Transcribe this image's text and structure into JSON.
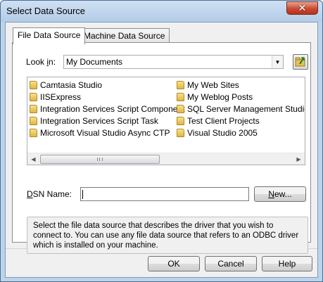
{
  "window": {
    "title": "Select Data Source",
    "close_label": "✕"
  },
  "tabs": [
    {
      "label": "File Data Source",
      "active": true
    },
    {
      "label": "Machine Data Source",
      "active": false
    }
  ],
  "look_in": {
    "label_prefix": "Look ",
    "label_underline": "i",
    "label_suffix": "n:",
    "value": "My Documents"
  },
  "files": [
    "Camtasia Studio",
    "IISExpress",
    "Integration Services Script Component",
    "Integration Services Script Task",
    "Microsoft Visual Studio Async CTP",
    "My Web Sites",
    "My Weblog Posts",
    "SQL Server Management Studio",
    "Test Client Projects",
    "Visual Studio 2005"
  ],
  "dsn": {
    "label_underline": "D",
    "label_rest": "SN Name:",
    "value": ""
  },
  "new_button": {
    "underline": "N",
    "rest": "ew..."
  },
  "description": "Select the file data source that describes the driver that you wish to connect to. You can use any file data source that refers to an ODBC driver which is installed on your machine.",
  "buttons": {
    "ok": "OK",
    "cancel": "Cancel",
    "help": "Help"
  },
  "colors": {
    "frame": "#bcd3ec",
    "close": "#c94a34",
    "folder": "#e0b545"
  }
}
